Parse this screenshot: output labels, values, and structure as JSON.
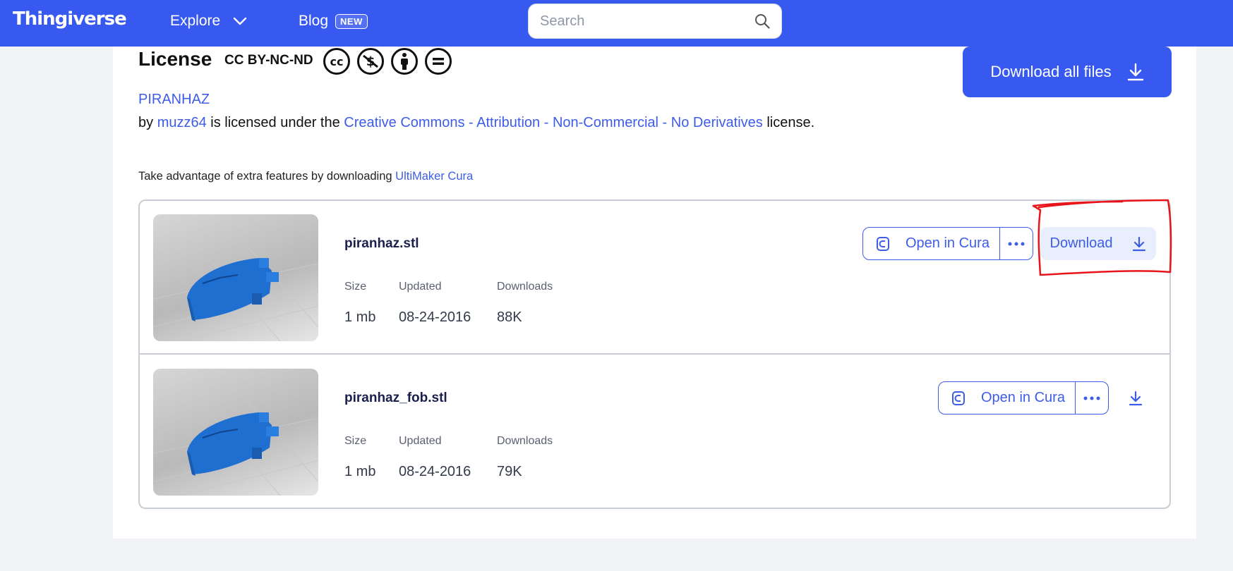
{
  "nav": {
    "logo": "Thingiverse",
    "explore_label": "Explore",
    "blog_label": "Blog",
    "blog_badge": "NEW",
    "search_placeholder": "Search"
  },
  "license": {
    "heading": "License",
    "code": "CC BY-NC-ND",
    "icons": [
      "creative-commons-icon",
      "non-commercial-icon",
      "attribution-icon",
      "no-derivatives-icon"
    ],
    "thing_name": "PIRANHAZ",
    "by_text": "by",
    "author": "muzz64",
    "licensed_text": "is licensed under the",
    "license_name": "Creative Commons - Attribution - Non-Commercial - No Derivatives",
    "license_suffix": "license."
  },
  "download_all_label": "Download all files",
  "cura_promo": {
    "text": "Take advantage of extra features by downloading",
    "link": "UltiMaker Cura"
  },
  "meta_labels": {
    "size": "Size",
    "updated": "Updated",
    "downloads": "Downloads"
  },
  "files": [
    {
      "name": "piranhaz.stl",
      "size": "1 mb",
      "updated": "08-24-2016",
      "downloads": "88K",
      "open_in_cura_label": "Open in Cura",
      "download_label": "Download"
    },
    {
      "name": "piranhaz_fob.stl",
      "size": "1 mb",
      "updated": "08-24-2016",
      "downloads": "79K",
      "open_in_cura_label": "Open in Cura"
    }
  ],
  "colors": {
    "brand": "#3859f0",
    "link": "#3d5ce8",
    "annotation": "#e8141b"
  }
}
